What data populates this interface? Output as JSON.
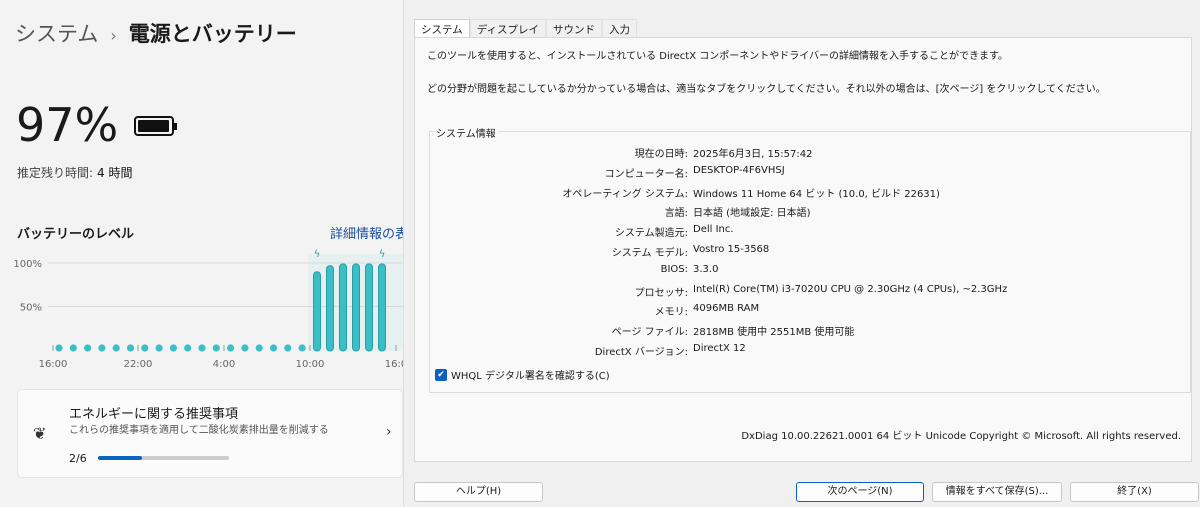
{
  "settings": {
    "breadcrumb_parent": "システム",
    "breadcrumb_sep": "›",
    "page_title": "電源とバッテリー",
    "battery_percent": "97%",
    "battery_level": 0.97,
    "estimate_label": "推定残り時間:",
    "estimate_value": "4 時間",
    "level_heading": "バッテリーのレベル",
    "details_link": "詳細情報の表",
    "card": {
      "title": "エネルギーに関する推奨事項",
      "subtitle": "これらの推奨事項を適用して二酸化炭素排出量を削減する",
      "progress_text": "2/6",
      "progress": 0.333
    }
  },
  "chart_data": {
    "type": "bar",
    "title": "バッテリーのレベル",
    "y_ticks": [
      "100%",
      "50%"
    ],
    "x_ticks": [
      "16:00",
      "22:00",
      "4:00",
      "10:00",
      "16:0"
    ],
    "ylim": [
      0,
      100
    ],
    "values": [
      3,
      3,
      3,
      3,
      3,
      3,
      3,
      3,
      3,
      3,
      3,
      3,
      3,
      3,
      3,
      3,
      3,
      3,
      90,
      97,
      99,
      99,
      99,
      99
    ],
    "charging": [
      18,
      23
    ],
    "color": "#3bbfc6"
  },
  "dxdiag": {
    "tabs": [
      "システム",
      "ディスプレイ",
      "サウンド",
      "入力"
    ],
    "intro1": "このツールを使用すると、インストールされている DirectX コンポーネントやドライバーの詳細情報を入手することができます。",
    "intro2": "どの分野が問題を起こしているか分かっている場合は、適当なタブをクリックしてください。それ以外の場合は、[次ページ] をクリックしてください。",
    "group_label": "システム情報",
    "rows": [
      {
        "k": "現在の日時:",
        "v": "2025年6月3日, 15:57:42"
      },
      {
        "k": "コンピューター名:",
        "v": "DESKTOP-4F6VHSJ"
      },
      {
        "k": "オペレーティング システム:",
        "v": "Windows 11 Home 64 ビット (10.0, ビルド 22631)"
      },
      {
        "k": "言語:",
        "v": "日本語 (地域設定: 日本語)"
      },
      {
        "k": "システム製造元:",
        "v": "Dell Inc."
      },
      {
        "k": "システム モデル:",
        "v": "Vostro 15-3568"
      },
      {
        "k": "BIOS:",
        "v": "3.3.0"
      },
      {
        "k": "プロセッサ:",
        "v": "Intel(R) Core(TM) i3-7020U CPU @ 2.30GHz (4 CPUs), ~2.3GHz"
      },
      {
        "k": "メモリ:",
        "v": "4096MB RAM"
      },
      {
        "k": "ページ ファイル:",
        "v": "2818MB 使用中 2551MB 使用可能"
      },
      {
        "k": "DirectX バージョン:",
        "v": "DirectX 12"
      }
    ],
    "whql": "WHQL デジタル署名を確認する(C)",
    "version": "DxDiag 10.00.22621.0001 64 ビット Unicode  Copyright © Microsoft. All rights reserved.",
    "buttons": {
      "help": "ヘルプ(H)",
      "next": "次のページ(N)",
      "save": "情報をすべて保存(S)...",
      "exit": "終了(X)"
    }
  }
}
